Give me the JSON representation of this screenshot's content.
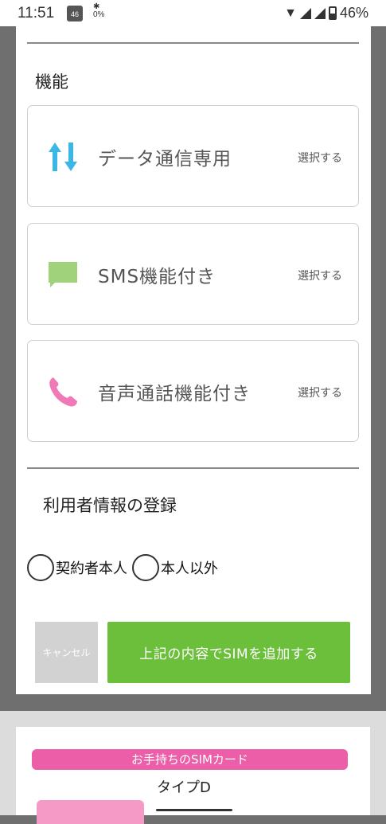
{
  "status_bar": {
    "time": "11:51",
    "app_badge": "46",
    "data_rate": "0%",
    "battery": "46%"
  },
  "functions_section": {
    "title": "機能",
    "select_label": "選択する",
    "options": [
      {
        "label": "データ通信専用",
        "icon": "up-down-arrows-icon",
        "color": "#3bb7e6"
      },
      {
        "label": "SMS機能付き",
        "icon": "chat-bubble-icon",
        "color": "#9fd27a"
      },
      {
        "label": "音声通話機能付き",
        "icon": "phone-icon",
        "color": "#f07ab8"
      }
    ]
  },
  "user_section": {
    "title": "利用者情報の登録",
    "radio_options": [
      "契約者本人",
      "本人以外"
    ]
  },
  "actions": {
    "cancel_label": "キャンセル",
    "add_label": "上記の内容でSIMを追加する"
  },
  "background_content": {
    "banner": "お手持ちのSIMカード",
    "type_label": "タイプD"
  },
  "colors": {
    "accent_green": "#6bbf3a",
    "accent_pink": "#ec5fa8"
  }
}
